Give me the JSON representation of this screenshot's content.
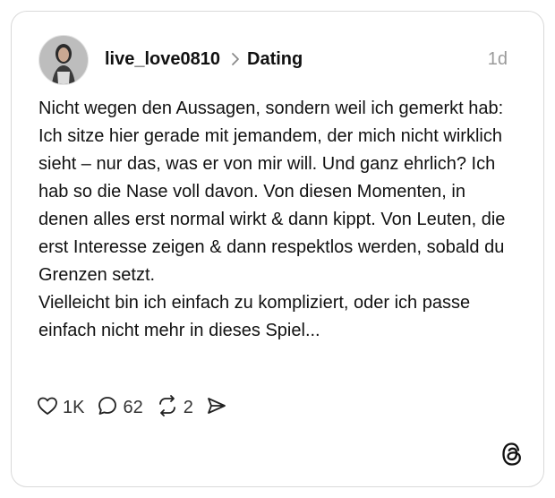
{
  "post": {
    "username": "live_love0810",
    "topic": "Dating",
    "time": "1d",
    "text": "Nicht wegen den Aussagen, sondern weil ich gemerkt hab: Ich sitze hier gerade mit jemandem, der mich nicht wirklich sieht – nur das, was er von mir will. Und ganz ehrlich? Ich hab so die Nase voll davon. Von diesen Momenten, in denen alles erst normal wirkt & dann kippt. Von Leuten, die erst Interesse zeigen & dann respektlos werden, sobald du Grenzen setzt.\nVielleicht bin ich einfach zu kompliziert, oder ich passe einfach nicht mehr in dieses Spiel..."
  },
  "actions": {
    "likes": "1K",
    "replies": "62",
    "reposts": "2"
  },
  "icons": [
    "avatar",
    "chevron-right-icon",
    "heart-icon",
    "comment-icon",
    "repost-icon",
    "share-icon",
    "threads-logo-icon"
  ]
}
